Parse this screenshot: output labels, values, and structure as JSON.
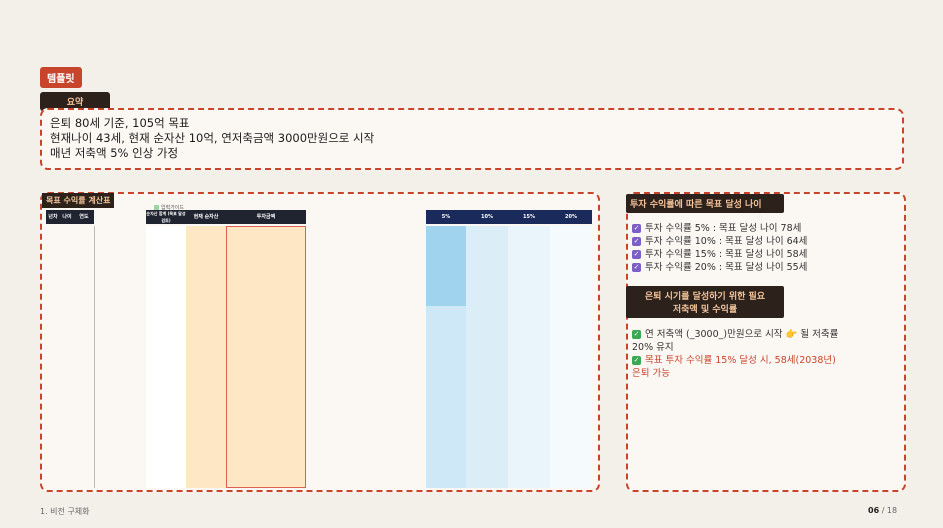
{
  "template_tag": "템플릿",
  "summary_pill": "요약",
  "summary_lines": [
    "은퇴 80세 기준, 105억 목표",
    "현재나이 43세, 현재 순자산 10억, 연저축금액 3000만원으로 시작",
    "매년 저축액 5% 인상 가정"
  ],
  "table_title": "목표 수익률 계산표",
  "legend_label": "입력가이드",
  "table_headers": [
    "년차",
    "나이",
    "연도",
    "순자산 합계\n(목표 달성 검토)",
    "현재 순자산",
    "투자금액",
    "5%",
    "10%",
    "15%",
    "20%"
  ],
  "right": {
    "pill1": "투자 수익률에 따른 목표 달성 나이",
    "items": [
      {
        "label": "투자 수익률 5% : 목표 달성 나이 78세"
      },
      {
        "label": "투자 수익률 10% : 목표 달성 나이 64세"
      },
      {
        "label": "투자 수익률 15% : 목표 달성 나이 58세"
      },
      {
        "label": "투자 수익률 20% : 목표 달성 나이 55세"
      }
    ],
    "pill2_line1": "은퇴 시기를 달성하기 위한 필요",
    "pill2_line2": "저축액 및 수익률",
    "note1_a": "연 저축액 (_3000_)만원으로 시작 👉 될 저축률",
    "note1_b": "20% 유지",
    "note2_a": "목표 투자 수익률 15% 달성 시, 58세(2038년)",
    "note2_b": "은퇴 가능"
  },
  "footer_left": "1. 비전 구체화",
  "footer_page": "06",
  "footer_total": "/ 18",
  "colors": {
    "accent": "#c8452c",
    "dark": "#2d211b"
  }
}
